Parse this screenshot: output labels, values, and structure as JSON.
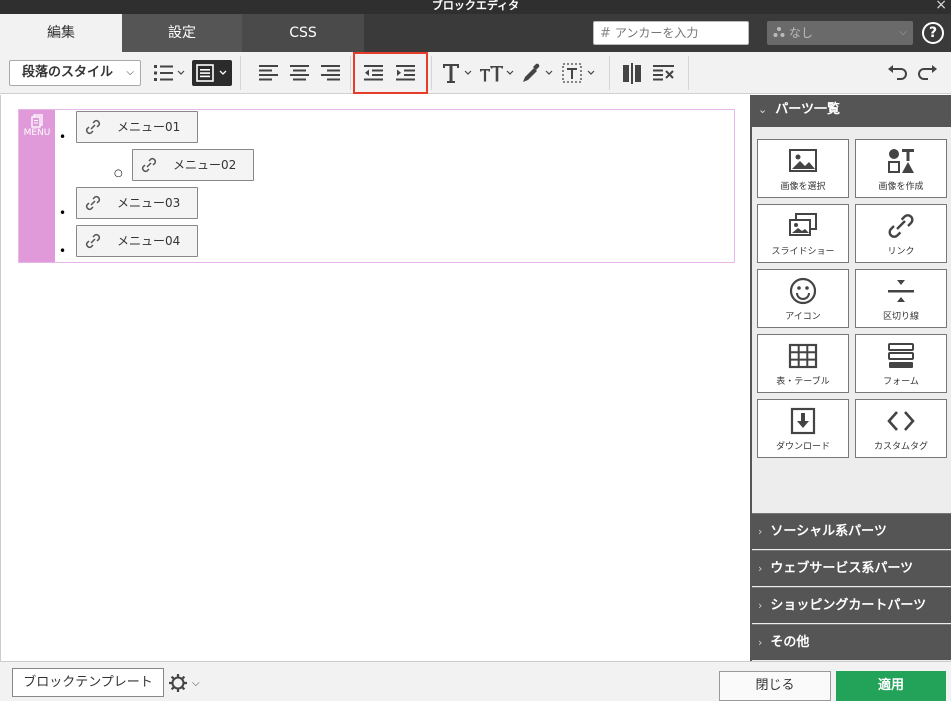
{
  "window": {
    "title": "ブロックエディタ",
    "close_glyph": "×"
  },
  "tabs": [
    {
      "label": "編集"
    },
    {
      "label": "設定"
    },
    {
      "label": "CSS"
    }
  ],
  "anchor": {
    "hash": "#",
    "placeholder": "アンカーを入力"
  },
  "layer_select": {
    "value": "なし"
  },
  "help": {
    "label": "?"
  },
  "toolbar": {
    "paragraph_style": "段落のスタイル",
    "highlighted_group": [
      "outdent",
      "indent"
    ]
  },
  "menu_block": {
    "label": "MENU",
    "items": [
      {
        "text": "メニュー01",
        "level": 1
      },
      {
        "text": "メニュー02",
        "level": 2
      },
      {
        "text": "メニュー03",
        "level": 1
      },
      {
        "text": "メニュー04",
        "level": 1
      }
    ]
  },
  "panel": {
    "title": "パーツ一覧",
    "parts": [
      {
        "label": "画像を選択",
        "icon": "image-icon"
      },
      {
        "label": "画像を作成",
        "icon": "shapes-icon"
      },
      {
        "label": "スライドショー",
        "icon": "slideshow-icon"
      },
      {
        "label": "リンク",
        "icon": "link-icon"
      },
      {
        "label": "アイコン",
        "icon": "smiley-icon"
      },
      {
        "label": "区切り線",
        "icon": "divider-icon"
      },
      {
        "label": "表・テーブル",
        "icon": "table-icon"
      },
      {
        "label": "フォーム",
        "icon": "form-icon"
      },
      {
        "label": "ダウンロード",
        "icon": "download-icon"
      },
      {
        "label": "カスタムタグ",
        "icon": "code-icon"
      }
    ],
    "sections": [
      {
        "label": "ソーシャル系パーツ"
      },
      {
        "label": "ウェブサービス系パーツ"
      },
      {
        "label": "ショッピングカートパーツ"
      },
      {
        "label": "その他"
      }
    ]
  },
  "footer": {
    "template_button": "ブロックテンプレート",
    "close_button": "閉じる",
    "apply_button": "適用"
  },
  "colors": {
    "accent_apply": "#23a259",
    "highlight": "#e53d2a",
    "menu_label": "#e09ad9"
  }
}
